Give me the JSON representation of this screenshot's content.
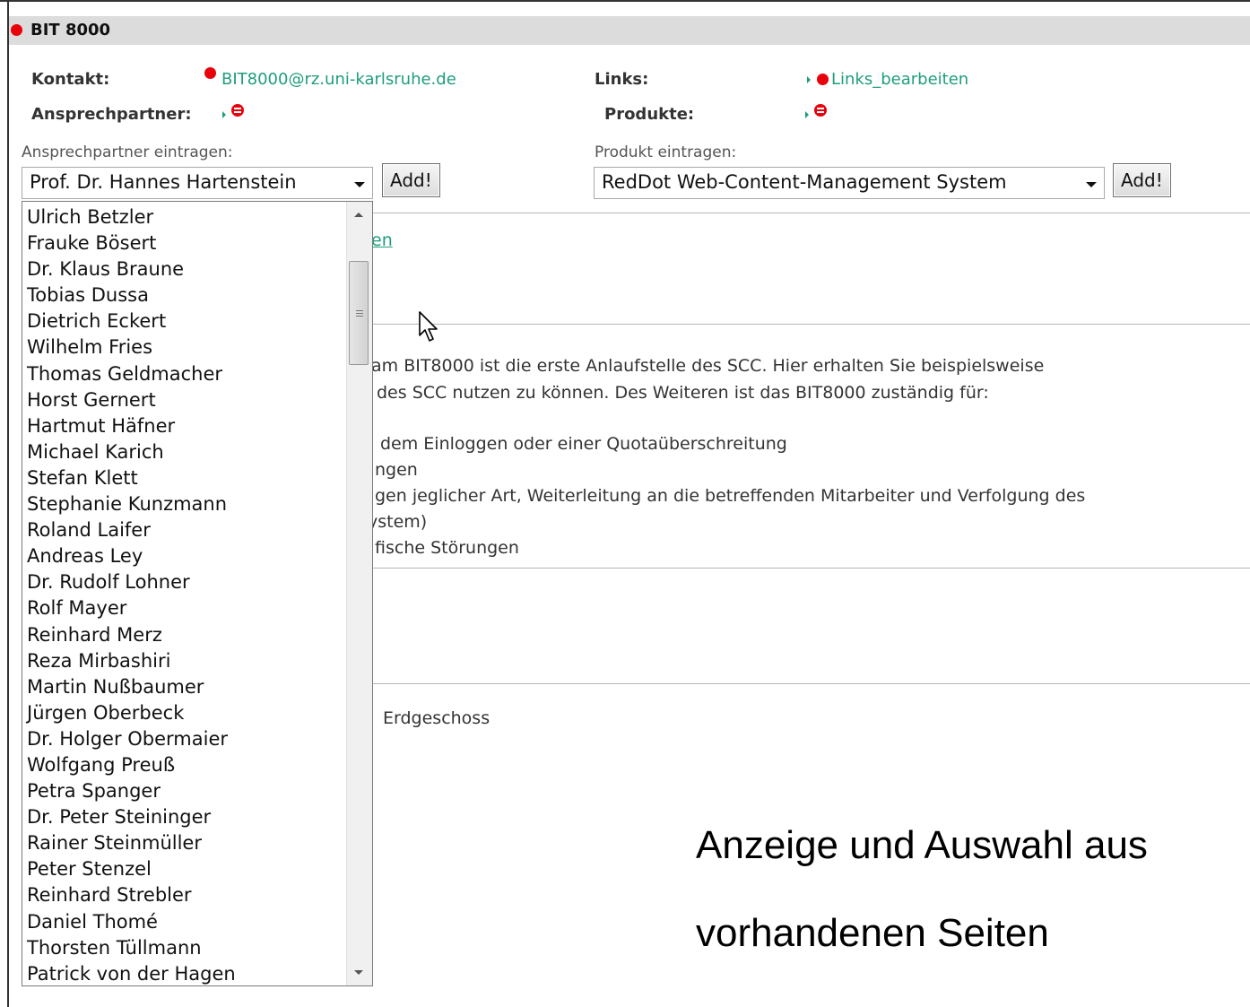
{
  "header": {
    "title": "BIT 8000"
  },
  "info": {
    "contact_label": "Kontakt:",
    "contact_email": "BIT8000@rz.uni-karlsruhe.de",
    "partner_label": "Ansprechpartner:",
    "links_label": "Links:",
    "links_value": "Links_bearbeiten",
    "products_label": "Produkte:"
  },
  "forms": {
    "partner_field_label": "Ansprechpartner eintragen:",
    "partner_selected": "Prof. Dr. Hannes Hartenstein",
    "partner_add": "Add!",
    "product_field_label": "Produkt eintragen:",
    "product_selected": "RedDot Web-Content-Management System",
    "product_add": "Add!"
  },
  "dropdown": {
    "options": [
      "Ulrich Betzler",
      "Frauke Bösert",
      "Dr. Klaus Braune",
      "Tobias Dussa",
      "Dietrich Eckert",
      "Wilhelm Fries",
      "Thomas Geldmacher",
      "Horst Gernert",
      "Hartmut Häfner",
      "Michael Karich",
      "Stefan Klett",
      "Stephanie Kunzmann",
      "Roland Laifer",
      "Andreas Ley",
      "Dr. Rudolf Lohner",
      "Rolf Mayer",
      "Reinhard Merz",
      "Reza Mirbashiri",
      "Martin Nußbaumer",
      "Jürgen Oberbeck",
      "Dr. Holger Obermaier",
      "Wolfgang Preuß",
      "Petra Spanger",
      "Dr. Peter Steininger",
      "Rainer Steinmüller",
      "Peter Stenzel",
      "Reinhard Strebler",
      "Daniel Thomé",
      "Thorsten Tüllmann",
      "Patrick von der Hagen"
    ]
  },
  "background": {
    "link_fragment": "en",
    "lines": [
      "am BIT8000 ist die erste Anlaufstelle des SCC. Hier erhalten Sie beispielsweise",
      "des SCC nutzen zu können. Des Weiteren ist das BIT8000  zuständig für:",
      "dem Einloggen oder einer Quotaüberschreitung",
      "ngen",
      "gen jeglicher Art, Weiterleitung an die betreffenden Mitarbeiter und Verfolgung des",
      "ystem)",
      "fische Störungen"
    ],
    "location": "Erdgeschoss"
  },
  "caption": {
    "line1": "Anzeige und Auswahl aus",
    "line2": "vorhandenen Seiten"
  },
  "colors": {
    "accent_red": "#e8000b",
    "link_green": "#1f9d7d"
  }
}
